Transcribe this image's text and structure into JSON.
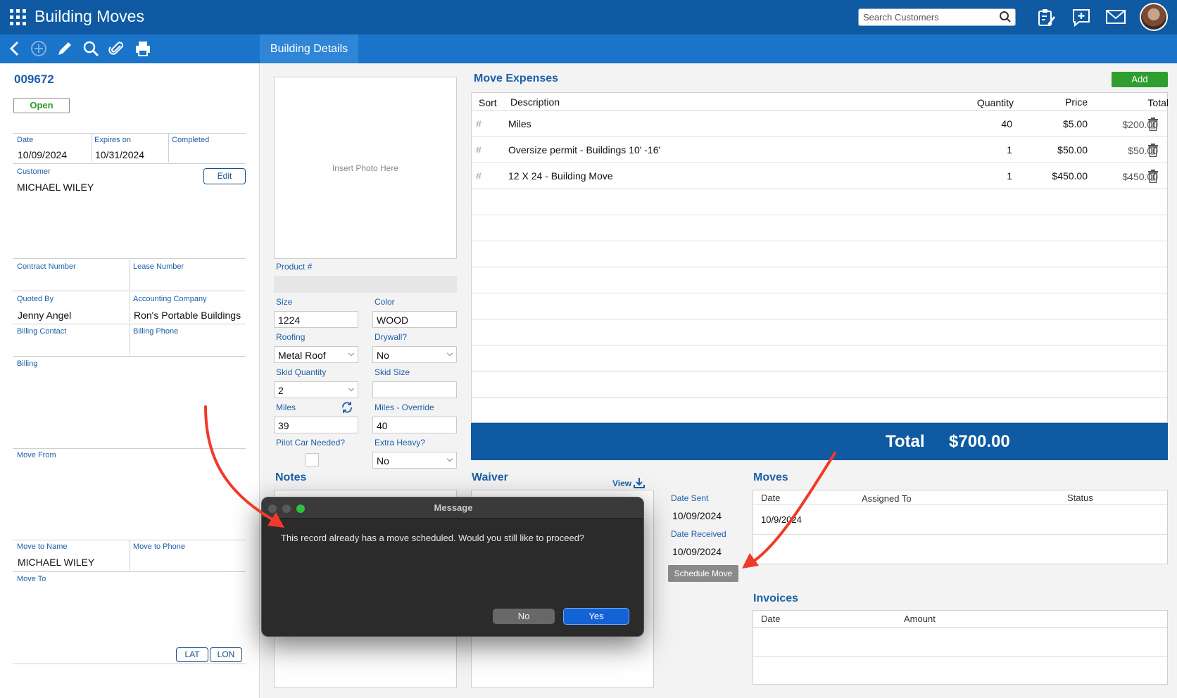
{
  "header": {
    "app_title": "Building Moves",
    "search_placeholder": "Search Customers",
    "icons": [
      "apps-grid-icon",
      "search-icon",
      "clipboard-edit-icon",
      "chat-add-icon",
      "mail-icon",
      "user-avatar"
    ]
  },
  "toolbar": {
    "icons": [
      "back-icon",
      "add-circle-icon",
      "edit-pencil-icon",
      "search-icon",
      "paperclip-icon",
      "print-icon"
    ],
    "tab_label": "Building Details"
  },
  "record": {
    "id": "009672",
    "status": "Open",
    "date_label": "Date",
    "date": "10/09/2024",
    "expires_label": "Expires on",
    "expires": "10/31/2024",
    "completed_label": "Completed",
    "completed": "",
    "customer_label": "Customer",
    "customer": "MICHAEL WILEY",
    "edit_label": "Edit",
    "contract_label": "Contract Number",
    "lease_label": "Lease Number",
    "quoted_by_label": "Quoted By",
    "quoted_by": "Jenny Angel",
    "accounting_label": "Accounting Company",
    "accounting": "Ron's Portable Buildings",
    "billing_contact_label": "Billing Contact",
    "billing_phone_label": "Billing Phone",
    "billing_label": "Billing",
    "move_from_label": "Move From",
    "move_to_name_label": "Move to Name",
    "move_to_name": "MICHAEL WILEY",
    "move_to_phone_label": "Move to Phone",
    "move_to_label": "Move To",
    "lat_label": "LAT",
    "lon_label": "LON"
  },
  "building": {
    "photo_placeholder": "Insert Photo Here",
    "product_label": "Product #",
    "size_label": "Size",
    "size": "1224",
    "color_label": "Color",
    "color": "WOOD",
    "roofing_label": "Roofing",
    "roofing": "Metal Roof",
    "drywall_label": "Drywall?",
    "drywall": "No",
    "skid_qty_label": "Skid Quantity",
    "skid_qty": "2",
    "skid_size_label": "Skid Size",
    "miles_label": "Miles",
    "miles": "39",
    "miles_override_label": "Miles - Override",
    "miles_override": "40",
    "pilot_label": "Pilot Car Needed?",
    "extra_heavy_label": "Extra Heavy?",
    "extra_heavy": "No",
    "notes_label": "Notes"
  },
  "expenses": {
    "title": "Move Expenses",
    "add_label": "Add",
    "columns": {
      "sort": "Sort",
      "description": "Description",
      "quantity": "Quantity",
      "price": "Price",
      "total": "Total"
    },
    "rows": [
      {
        "sort": "#",
        "description": "Miles",
        "quantity": "40",
        "price": "$5.00",
        "total": "$200.00"
      },
      {
        "sort": "#",
        "description": "Oversize permit - Buildings 10' -16'",
        "quantity": "1",
        "price": "$50.00",
        "total": "$50.00"
      },
      {
        "sort": "#",
        "description": "12 X 24 - Building Move",
        "quantity": "1",
        "price": "$450.00",
        "total": "$450.00"
      }
    ],
    "total_label": "Total",
    "total_value": "$700.00"
  },
  "waiver": {
    "title": "Waiver",
    "view_label": "View",
    "date_sent_label": "Date Sent",
    "date_sent": "10/09/2024",
    "date_received_label": "Date Received",
    "date_received": "10/09/2024",
    "schedule_move_label": "Schedule Move"
  },
  "moves": {
    "title": "Moves",
    "columns": {
      "date": "Date",
      "assigned": "Assigned To",
      "status": "Status"
    },
    "rows": [
      {
        "date": "10/9/2024",
        "assigned": "",
        "status": ""
      }
    ]
  },
  "invoices": {
    "title": "Invoices",
    "columns": {
      "date": "Date",
      "amount": "Amount"
    }
  },
  "dialog": {
    "title": "Message",
    "message": "This record already has a move scheduled. Would you still like to proceed?",
    "no_label": "No",
    "yes_label": "Yes"
  },
  "colors": {
    "header_blue": "#0f5aa3",
    "toolbar_blue": "#1a74c9",
    "label_blue": "#1d5fa8",
    "add_green": "#2e9e2e",
    "annotation_red": "#f03a2a"
  }
}
